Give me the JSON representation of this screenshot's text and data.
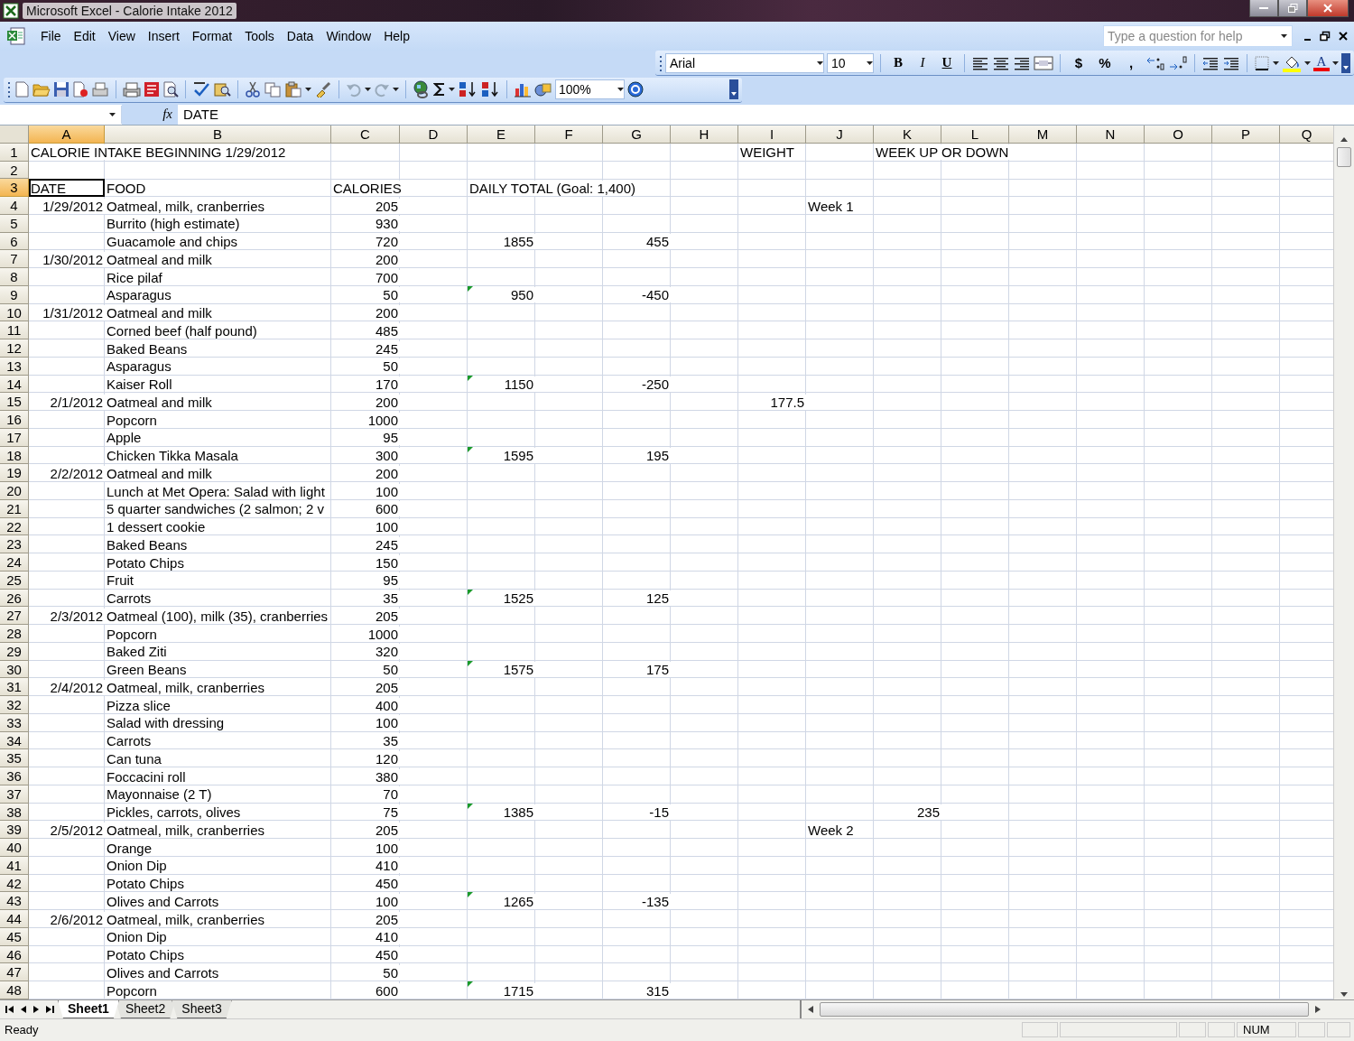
{
  "window": {
    "title": "Microsoft Excel - Calorie Intake 2012"
  },
  "menu": [
    "File",
    "Edit",
    "View",
    "Insert",
    "Format",
    "Tools",
    "Data",
    "Window",
    "Help"
  ],
  "help_box": {
    "placeholder": "Type a question for help"
  },
  "formatting_toolbar": {
    "font": "Arial",
    "size": "10",
    "style_buttons": [
      "B",
      "I",
      "U"
    ],
    "number_buttons": [
      "$",
      "%",
      ","
    ],
    "font_color_button": "A"
  },
  "standard_toolbar": {
    "zoom": "100%"
  },
  "formula_bar": {
    "function_label": "fx",
    "formula": "DATE"
  },
  "sheet": {
    "columns": [
      {
        "label": "A",
        "selected": true
      },
      {
        "label": "B",
        "selected": false
      },
      {
        "label": "C",
        "selected": false
      },
      {
        "label": "D",
        "selected": false
      },
      {
        "label": "E",
        "selected": false
      },
      {
        "label": "F",
        "selected": false
      },
      {
        "label": "G",
        "selected": false
      },
      {
        "label": "H",
        "selected": false
      },
      {
        "label": "I",
        "selected": false
      },
      {
        "label": "J",
        "selected": false
      },
      {
        "label": "K",
        "selected": false
      },
      {
        "label": "L",
        "selected": false
      },
      {
        "label": "M",
        "selected": false
      },
      {
        "label": "N",
        "selected": false
      },
      {
        "label": "O",
        "selected": false
      },
      {
        "label": "P",
        "selected": false
      },
      {
        "label": "Q",
        "selected": false
      }
    ],
    "rows": [
      {
        "label": "1",
        "kind": "label",
        "selected": false,
        "error_mark": false,
        "cells": {
          "column_a": "CALORIE INTAKE BEGINNING 1/29/2012",
          "column_i": "WEIGHT",
          "column_k": "WEEK UP OR DOWN"
        }
      },
      {
        "label": "2",
        "kind": "label",
        "selected": false,
        "error_mark": false,
        "cells": {}
      },
      {
        "label": "3",
        "kind": "label",
        "selected": true,
        "error_mark": false,
        "cells": {
          "column_a": "DATE",
          "column_b": "FOOD",
          "column_c": "CALORIES",
          "column_e": "DAILY TOTAL (Goal: 1,400)"
        }
      },
      {
        "label": "4",
        "kind": "entry",
        "selected": false,
        "error_mark": false,
        "cells": {
          "column_a": "1/29/2012",
          "column_b": "Oatmeal, milk, cranberries",
          "column_c": "205",
          "column_j": "Week 1"
        }
      },
      {
        "label": "5",
        "kind": "entry",
        "selected": false,
        "error_mark": false,
        "cells": {
          "column_b": "Burrito (high estimate)",
          "column_c": "930"
        }
      },
      {
        "label": "6",
        "kind": "entry",
        "selected": false,
        "error_mark": false,
        "cells": {
          "column_b": "Guacamole and chips",
          "column_c": "720",
          "column_e": "1855",
          "column_g": "455"
        }
      },
      {
        "label": "7",
        "kind": "entry",
        "selected": false,
        "error_mark": false,
        "cells": {
          "column_a": "1/30/2012",
          "column_b": "Oatmeal and milk",
          "column_c": "200"
        }
      },
      {
        "label": "8",
        "kind": "entry",
        "selected": false,
        "error_mark": false,
        "cells": {
          "column_b": "Rice pilaf",
          "column_c": "700"
        }
      },
      {
        "label": "9",
        "kind": "entry",
        "selected": false,
        "error_mark": true,
        "cells": {
          "column_b": "Asparagus",
          "column_c": "50",
          "column_e": "950",
          "column_g": "-450"
        }
      },
      {
        "label": "10",
        "kind": "entry",
        "selected": false,
        "error_mark": false,
        "cells": {
          "column_a": "1/31/2012",
          "column_b": "Oatmeal and milk",
          "column_c": "200"
        }
      },
      {
        "label": "11",
        "kind": "entry",
        "selected": false,
        "error_mark": false,
        "cells": {
          "column_b": "Corned beef (half pound)",
          "column_c": "485"
        }
      },
      {
        "label": "12",
        "kind": "entry",
        "selected": false,
        "error_mark": false,
        "cells": {
          "column_b": "Baked Beans",
          "column_c": "245"
        }
      },
      {
        "label": "13",
        "kind": "entry",
        "selected": false,
        "error_mark": false,
        "cells": {
          "column_b": "Asparagus",
          "column_c": "50"
        }
      },
      {
        "label": "14",
        "kind": "entry",
        "selected": false,
        "error_mark": true,
        "cells": {
          "column_b": "Kaiser Roll",
          "column_c": "170",
          "column_e": "1150",
          "column_g": "-250"
        }
      },
      {
        "label": "15",
        "kind": "entry",
        "selected": false,
        "error_mark": false,
        "cells": {
          "column_a": "2/1/2012",
          "column_b": "Oatmeal and milk",
          "column_c": "200",
          "column_i": "177.5"
        }
      },
      {
        "label": "16",
        "kind": "entry",
        "selected": false,
        "error_mark": false,
        "cells": {
          "column_b": "Popcorn",
          "column_c": "1000"
        }
      },
      {
        "label": "17",
        "kind": "entry",
        "selected": false,
        "error_mark": false,
        "cells": {
          "column_b": "Apple",
          "column_c": "95"
        }
      },
      {
        "label": "18",
        "kind": "entry",
        "selected": false,
        "error_mark": true,
        "cells": {
          "column_b": "Chicken Tikka Masala",
          "column_c": "300",
          "column_e": "1595",
          "column_g": "195"
        }
      },
      {
        "label": "19",
        "kind": "entry",
        "selected": false,
        "error_mark": false,
        "cells": {
          "column_a": "2/2/2012",
          "column_b": "Oatmeal and milk",
          "column_c": "200"
        }
      },
      {
        "label": "20",
        "kind": "entry",
        "selected": false,
        "error_mark": false,
        "cells": {
          "column_b": "Lunch at Met Opera: Salad with light",
          "column_c": "100"
        }
      },
      {
        "label": "21",
        "kind": "entry",
        "selected": false,
        "error_mark": false,
        "cells": {
          "column_b": "5 quarter sandwiches (2 salmon; 2 v",
          "column_c": "600"
        }
      },
      {
        "label": "22",
        "kind": "entry",
        "selected": false,
        "error_mark": false,
        "cells": {
          "column_b": "1 dessert cookie",
          "column_c": "100"
        }
      },
      {
        "label": "23",
        "kind": "entry",
        "selected": false,
        "error_mark": false,
        "cells": {
          "column_b": "Baked Beans",
          "column_c": "245"
        }
      },
      {
        "label": "24",
        "kind": "entry",
        "selected": false,
        "error_mark": false,
        "cells": {
          "column_b": "Potato Chips",
          "column_c": "150"
        }
      },
      {
        "label": "25",
        "kind": "entry",
        "selected": false,
        "error_mark": false,
        "cells": {
          "column_b": "Fruit",
          "column_c": "95"
        }
      },
      {
        "label": "26",
        "kind": "entry",
        "selected": false,
        "error_mark": true,
        "cells": {
          "column_b": "Carrots",
          "column_c": "35",
          "column_e": "1525",
          "column_g": "125"
        }
      },
      {
        "label": "27",
        "kind": "entry",
        "selected": false,
        "error_mark": false,
        "cells": {
          "column_a": "2/3/2012",
          "column_b": "Oatmeal (100), milk (35), cranberries",
          "column_c": "205"
        }
      },
      {
        "label": "28",
        "kind": "entry",
        "selected": false,
        "error_mark": false,
        "cells": {
          "column_b": "Popcorn",
          "column_c": "1000"
        }
      },
      {
        "label": "29",
        "kind": "entry",
        "selected": false,
        "error_mark": false,
        "cells": {
          "column_b": "Baked Ziti",
          "column_c": "320"
        }
      },
      {
        "label": "30",
        "kind": "entry",
        "selected": false,
        "error_mark": true,
        "cells": {
          "column_b": "Green Beans",
          "column_c": "50",
          "column_e": "1575",
          "column_g": "175"
        }
      },
      {
        "label": "31",
        "kind": "entry",
        "selected": false,
        "error_mark": false,
        "cells": {
          "column_a": "2/4/2012",
          "column_b": "Oatmeal, milk, cranberries",
          "column_c": "205"
        }
      },
      {
        "label": "32",
        "kind": "entry",
        "selected": false,
        "error_mark": false,
        "cells": {
          "column_b": "Pizza slice",
          "column_c": "400"
        }
      },
      {
        "label": "33",
        "kind": "entry",
        "selected": false,
        "error_mark": false,
        "cells": {
          "column_b": "Salad with dressing",
          "column_c": "100"
        }
      },
      {
        "label": "34",
        "kind": "entry",
        "selected": false,
        "error_mark": false,
        "cells": {
          "column_b": "Carrots",
          "column_c": "35"
        }
      },
      {
        "label": "35",
        "kind": "entry",
        "selected": false,
        "error_mark": false,
        "cells": {
          "column_b": "Can tuna",
          "column_c": "120"
        }
      },
      {
        "label": "36",
        "kind": "entry",
        "selected": false,
        "error_mark": false,
        "cells": {
          "column_b": "Foccacini roll",
          "column_c": "380"
        }
      },
      {
        "label": "37",
        "kind": "entry",
        "selected": false,
        "error_mark": false,
        "cells": {
          "column_b": "Mayonnaise (2 T)",
          "column_c": "70"
        }
      },
      {
        "label": "38",
        "kind": "entry",
        "selected": false,
        "error_mark": true,
        "cells": {
          "column_b": "Pickles, carrots, olives",
          "column_c": "75",
          "column_e": "1385",
          "column_g": "-15",
          "column_k": "235"
        }
      },
      {
        "label": "39",
        "kind": "entry",
        "selected": false,
        "error_mark": false,
        "cells": {
          "column_a": "2/5/2012",
          "column_b": "Oatmeal, milk, cranberries",
          "column_c": "205",
          "column_j": "Week 2"
        }
      },
      {
        "label": "40",
        "kind": "entry",
        "selected": false,
        "error_mark": false,
        "cells": {
          "column_b": "Orange",
          "column_c": "100"
        }
      },
      {
        "label": "41",
        "kind": "entry",
        "selected": false,
        "error_mark": false,
        "cells": {
          "column_b": "Onion Dip",
          "column_c": "410"
        }
      },
      {
        "label": "42",
        "kind": "entry",
        "selected": false,
        "error_mark": false,
        "cells": {
          "column_b": "Potato Chips",
          "column_c": "450"
        }
      },
      {
        "label": "43",
        "kind": "entry",
        "selected": false,
        "error_mark": true,
        "cells": {
          "column_b": "Olives and Carrots",
          "column_c": "100",
          "column_e": "1265",
          "column_g": "-135"
        }
      },
      {
        "label": "44",
        "kind": "entry",
        "selected": false,
        "error_mark": false,
        "cells": {
          "column_a": "2/6/2012",
          "column_b": "Oatmeal, milk, cranberries",
          "column_c": "205"
        }
      },
      {
        "label": "45",
        "kind": "entry",
        "selected": false,
        "error_mark": false,
        "cells": {
          "column_b": "Onion Dip",
          "column_c": "410"
        }
      },
      {
        "label": "46",
        "kind": "entry",
        "selected": false,
        "error_mark": false,
        "cells": {
          "column_b": "Potato Chips",
          "column_c": "450"
        }
      },
      {
        "label": "47",
        "kind": "entry",
        "selected": false,
        "error_mark": false,
        "cells": {
          "column_b": "Olives and Carrots",
          "column_c": "50"
        }
      },
      {
        "label": "48",
        "kind": "entry",
        "selected": false,
        "error_mark": true,
        "cells": {
          "column_b": "Popcorn",
          "column_c": "600",
          "column_e": "1715",
          "column_g": "315"
        }
      }
    ]
  },
  "sheet_tabs": [
    {
      "label": "Sheet1",
      "selected": true
    },
    {
      "label": "Sheet2",
      "selected": false
    },
    {
      "label": "Sheet3",
      "selected": false
    }
  ],
  "status_bar": {
    "text": "Ready",
    "indicators": [
      "NUM"
    ]
  }
}
